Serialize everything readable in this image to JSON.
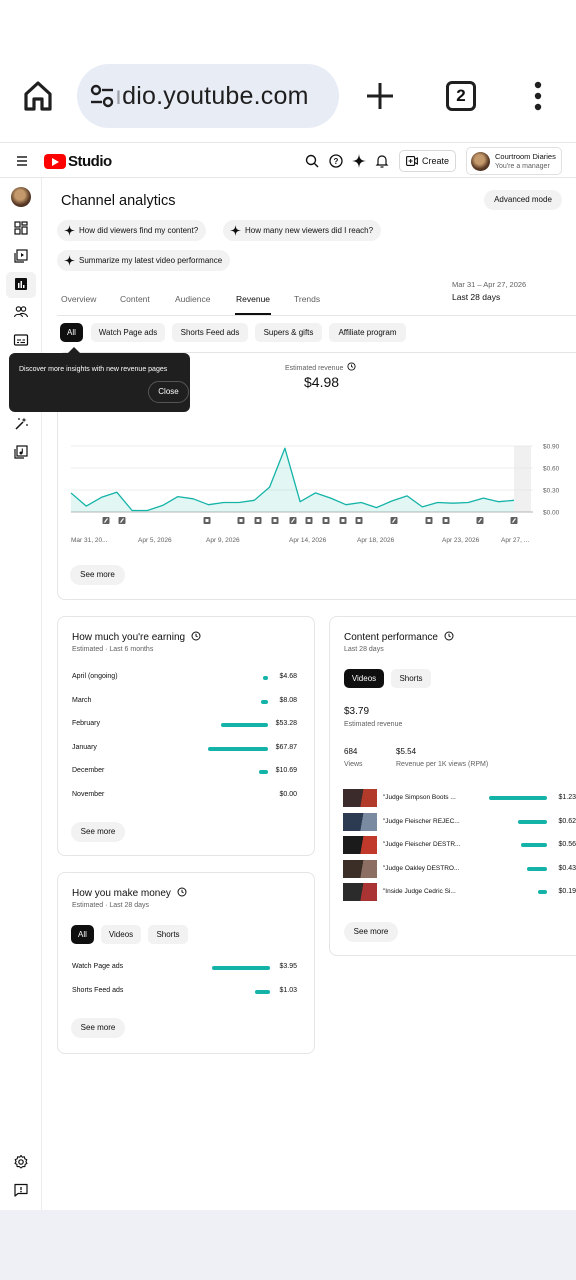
{
  "browser": {
    "url_hidden_part": "ı",
    "url_visible": "dio.youtube.com",
    "tab_count": "2"
  },
  "header": {
    "logo_text": "Studio",
    "create_label": "Create",
    "account_name": "Courtroom Diaries",
    "account_role": "You're a manager"
  },
  "page": {
    "title": "Channel analytics",
    "advanced_mode": "Advanced mode",
    "suggestions": [
      "How did viewers find my content?",
      "How many new viewers did I reach?",
      "Summarize my latest video performance"
    ],
    "tabs": [
      "Overview",
      "Content",
      "Audience",
      "Revenue",
      "Trends"
    ],
    "active_tab": "Revenue",
    "date_range": "Mar 31 – Apr 27, 2026",
    "date_label": "Last 28 days",
    "filters": [
      "All",
      "Watch Page ads",
      "Shorts Feed ads",
      "Supers & gifts",
      "Affiliate program"
    ],
    "active_filter": "All"
  },
  "tooltip": {
    "message": "Discover more insights with new revenue pages",
    "close_label": "Close"
  },
  "revenue_chart": {
    "metric_label": "Estimated revenue",
    "total": "$4.98",
    "see_more": "See more"
  },
  "chart_data": {
    "type": "area",
    "title": "",
    "x_tick_labels": [
      "Mar 31, 20...",
      "Apr 5, 2026",
      "Apr 9, 2026",
      "Apr 14, 2026",
      "Apr 18, 2026",
      "Apr 23, 2026",
      "Apr 27, ..."
    ],
    "y_tick_labels": [
      "$0.90",
      "$0.60",
      "$0.30",
      "$0.00"
    ],
    "ylim": [
      0,
      0.9
    ],
    "series": [
      {
        "values": [
          0.26,
          0.08,
          0.2,
          0.27,
          0.02,
          0.02,
          0.09,
          0.21,
          0.18,
          0.1,
          0.13,
          0.13,
          0.16,
          0.34,
          0.87,
          0.14,
          0.26,
          0.19,
          0.1,
          0.13,
          0.06,
          0.15,
          0.22,
          0.07,
          0.13,
          0.12,
          0.13,
          0.19,
          0.14,
          0.16
        ]
      }
    ],
    "color": "#14b3a8",
    "grid": true,
    "y_axis_side": "right",
    "markers": [
      "short",
      "short",
      "video",
      "video",
      "video",
      "video",
      "short",
      "video",
      "video",
      "video",
      "video",
      "short",
      "video",
      "video",
      "short",
      "short"
    ]
  },
  "earning": {
    "title": "How much you're earning",
    "subtitle": "Estimated · Last 6 months",
    "rows": [
      {
        "month": "April (ongoing)",
        "value": "$4.68",
        "amount": 4.68
      },
      {
        "month": "March",
        "value": "$8.08",
        "amount": 8.08
      },
      {
        "month": "February",
        "value": "$53.28",
        "amount": 53.28
      },
      {
        "month": "January",
        "value": "$67.87",
        "amount": 67.87
      },
      {
        "month": "December",
        "value": "$10.69",
        "amount": 10.69
      },
      {
        "month": "November",
        "value": "$0.00",
        "amount": 0
      }
    ],
    "see_more": "See more"
  },
  "money": {
    "title": "How you make money",
    "subtitle": "Estimated · Last 28 days",
    "segments": [
      "All",
      "Videos",
      "Shorts"
    ],
    "rows": [
      {
        "label": "Watch Page ads",
        "value": "$3.95",
        "amount": 3.95
      },
      {
        "label": "Shorts Feed ads",
        "value": "$1.03",
        "amount": 1.03
      }
    ],
    "see_more": "See more"
  },
  "content": {
    "title": "Content performance",
    "subtitle": "Last 28 days",
    "segments": [
      "Videos",
      "Shorts"
    ],
    "revenue": "$3.79",
    "revenue_label": "Estimated revenue",
    "views": "684",
    "views_label": "Views",
    "rpm": "$5.54",
    "rpm_label": "Revenue per 1K views (RPM)",
    "videos": [
      {
        "title": "\"Judge Simpson Boots ...",
        "value": "$1.23",
        "amount": 1.23
      },
      {
        "title": "\"Judge Fleischer REJEC...",
        "value": "$0.62",
        "amount": 0.62
      },
      {
        "title": "\"Judge Fleischer DESTR...",
        "value": "$0.56",
        "amount": 0.56
      },
      {
        "title": "\"Judge Oakley DESTRO...",
        "value": "$0.43",
        "amount": 0.43
      },
      {
        "title": "\"Inside Judge Cedric Si...",
        "value": "$0.19",
        "amount": 0.19
      }
    ],
    "see_more": "See more"
  }
}
